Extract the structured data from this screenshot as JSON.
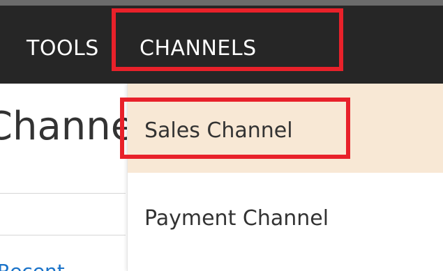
{
  "navbar": {
    "items": [
      {
        "label": "TOOLS"
      },
      {
        "label": "CHANNELS"
      }
    ]
  },
  "page": {
    "title": "Sales Channel",
    "link_partial": "Recent"
  },
  "dropdown": {
    "items": [
      {
        "label": "Sales Channel",
        "highlighted": true
      },
      {
        "label": "Payment Channel",
        "highlighted": false
      }
    ]
  },
  "colors": {
    "navbar_bg": "#262626",
    "highlight_border": "#e8212a",
    "active_item_bg": "#f8e8d5"
  }
}
